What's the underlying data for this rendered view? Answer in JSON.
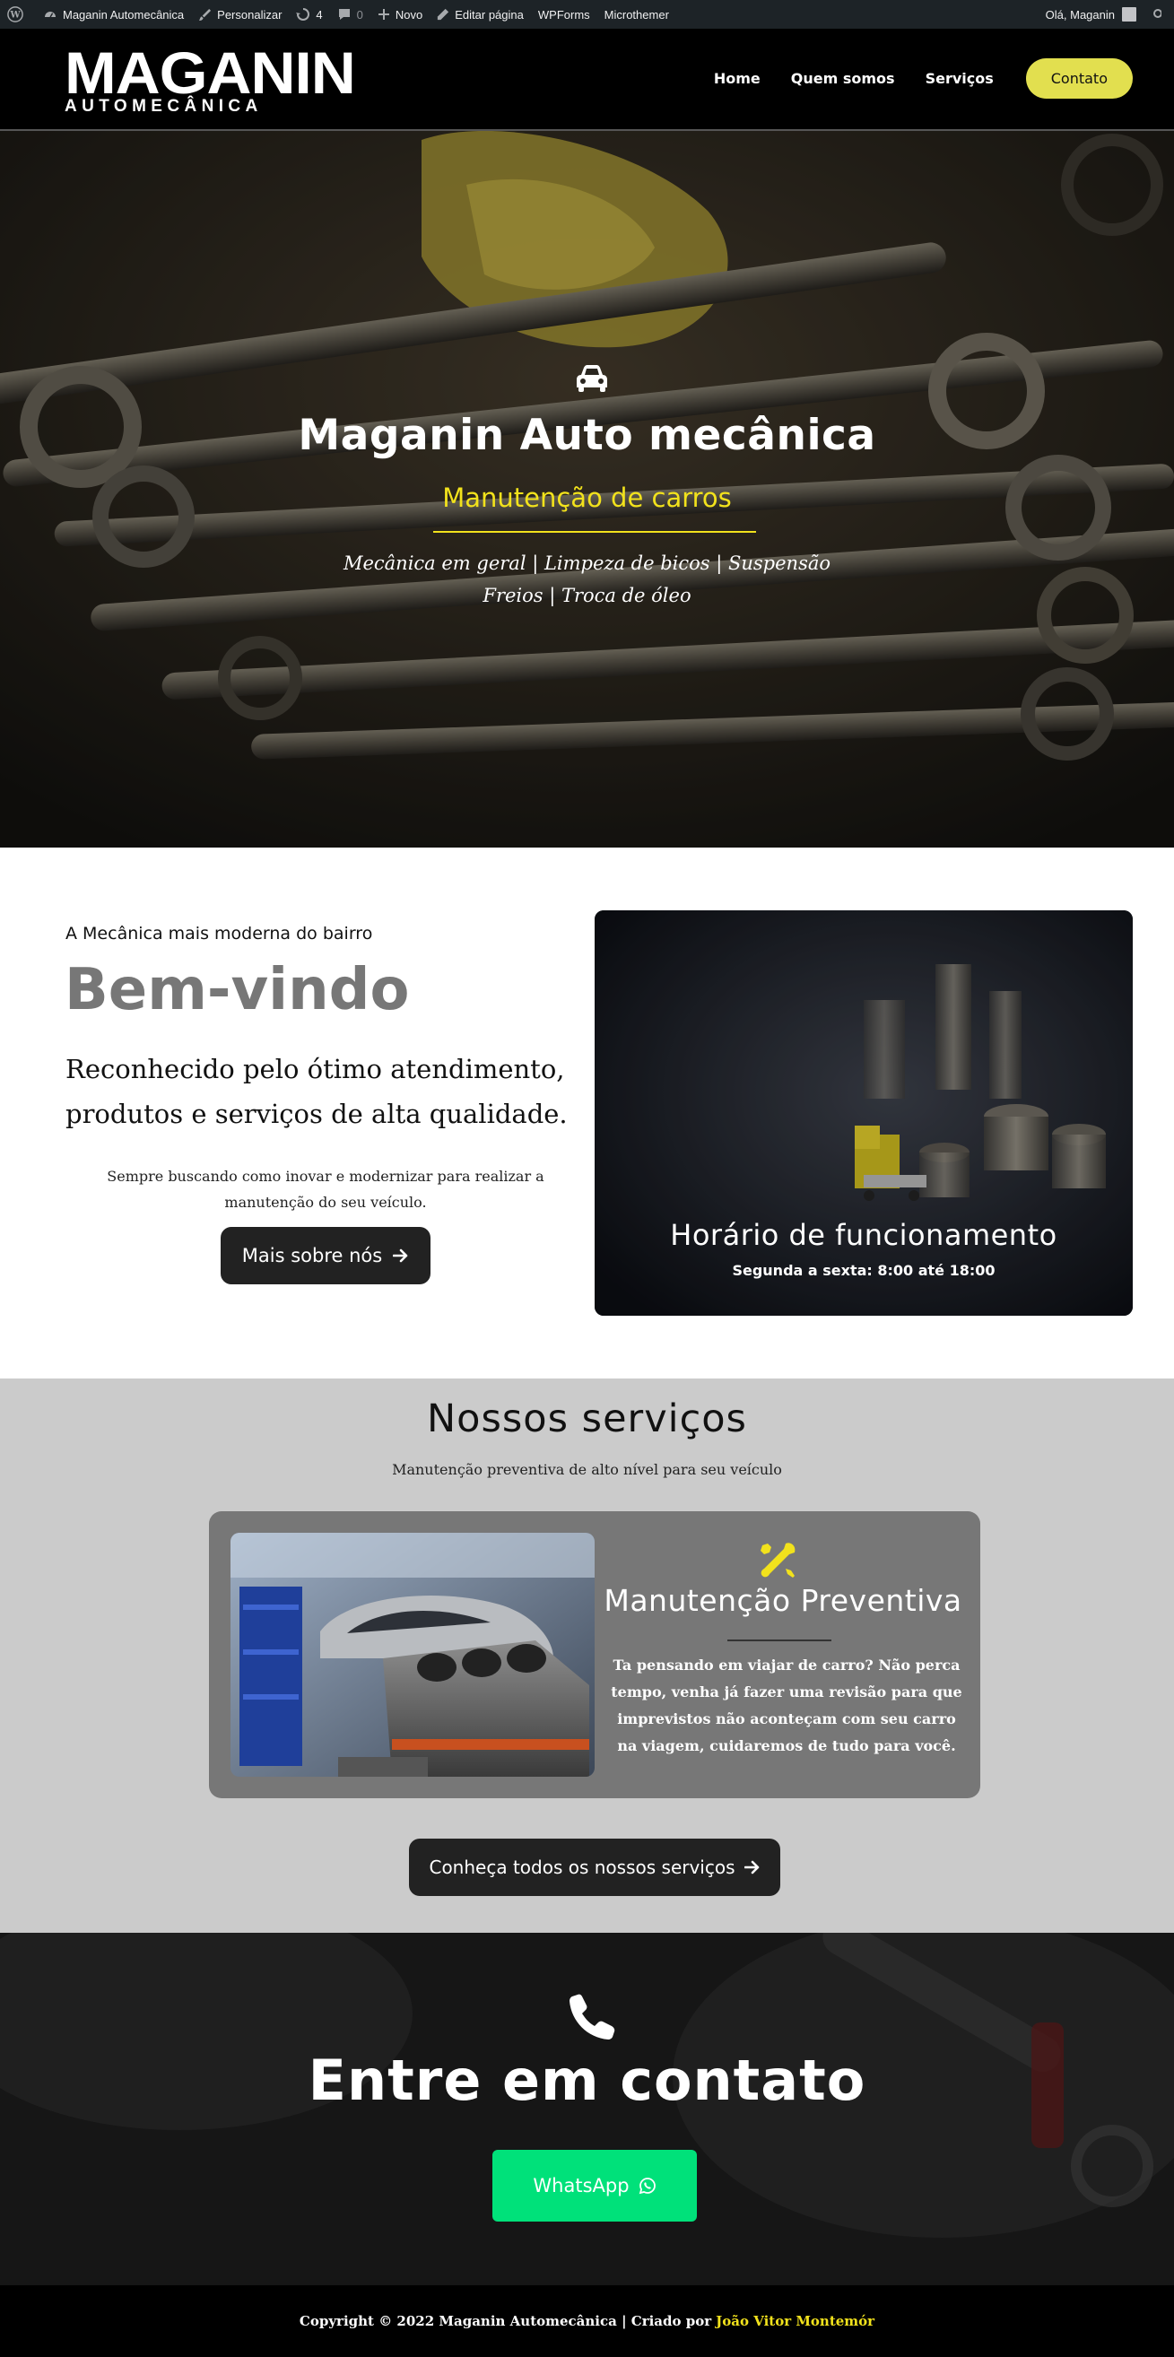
{
  "adminbar": {
    "site_name": "Maganin Automecânica",
    "customize": "Personalizar",
    "updates_count": "4",
    "comments_count": "0",
    "new": "Novo",
    "edit_page": "Editar página",
    "wpforms": "WPForms",
    "microthemer": "Microthemer",
    "greeting": "Olá, Maganin"
  },
  "header": {
    "logo_main": "MAGANIN",
    "logo_sub": "AUTOMECÂNICA",
    "nav": [
      "Home",
      "Quem somos",
      "Serviços"
    ],
    "contact_button": "Contato",
    "contact_button_color": "#e2df4f"
  },
  "hero": {
    "icon": "car-icon",
    "title": "Maganin Auto mecânica",
    "subtitle": "Manutenção de carros",
    "accent_color": "#f2e21c",
    "services_line1": "Mecânica em geral | Limpeza de bicos | Suspensão",
    "services_line2": "Freios | Troca de óleo"
  },
  "welcome": {
    "eyebrow": "A Mecânica mais moderna do bairro",
    "title": "Bem-vindo",
    "lead": "Reconhecido pelo ótimo atendimento, produtos e serviços de alta qualidade.",
    "text": "Sempre buscando como inovar e modernizar para realizar a manutenção do seu veículo.",
    "button": "Mais sobre nós",
    "hours_title": "Horário de funcionamento",
    "hours_text": "Segunda a sexta: 8:00 até 18:00"
  },
  "services": {
    "title": "Nossos serviços",
    "subtitle": "Manutenção preventiva de alto nível para seu veículo",
    "card": {
      "icon": "wrench-screwdriver-icon",
      "title": "Manutenção Preventiva",
      "text": "Ta pensando em viajar de carro? Não perca tempo, venha já fazer uma revisão para que imprevistos não aconteçam com seu carro na viagem, cuidaremos de tudo para você.",
      "icon_color": "#f2e21c"
    },
    "button": "Conheça todos os nossos serviços"
  },
  "contact": {
    "icon": "phone-icon",
    "title": "Entre em contato",
    "whatsapp_button": "WhatsApp",
    "whatsapp_color": "#00e17a"
  },
  "footer": {
    "copyright": "Copyright © 2022 Maganin Automecânica | Criado por",
    "author": "João Vitor Montemór"
  }
}
